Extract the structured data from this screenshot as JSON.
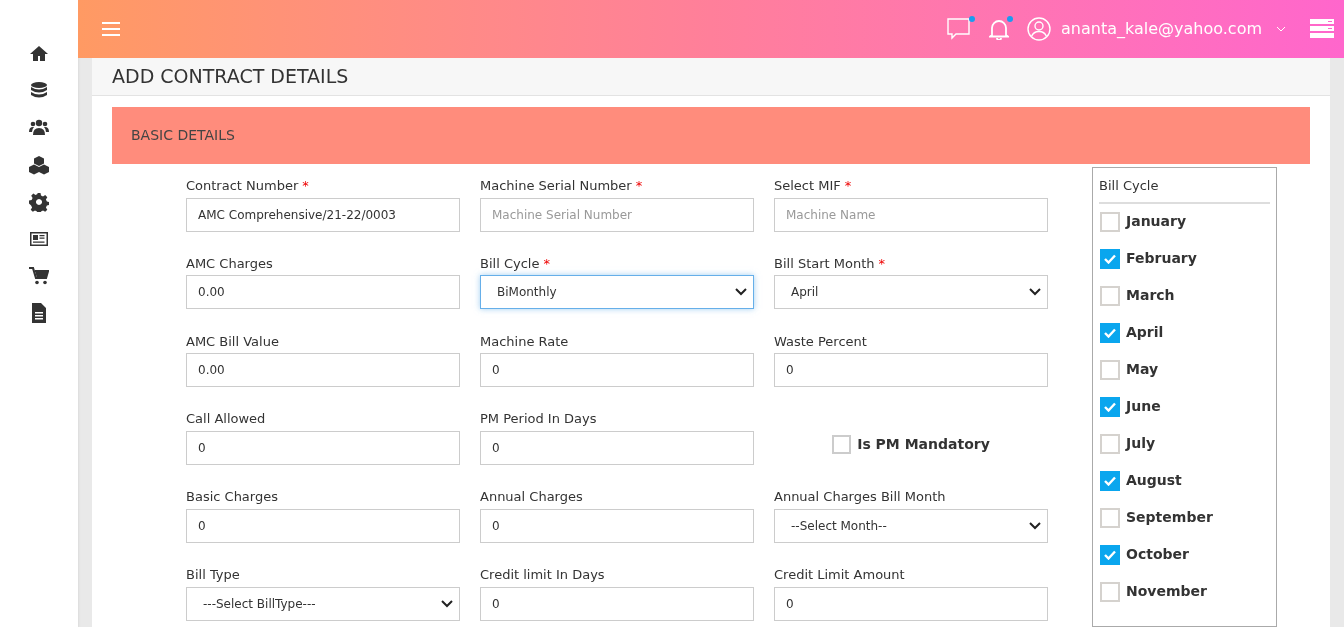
{
  "header": {
    "user": "ananta_kale@yahoo.com",
    "chat_unread": true,
    "bell_unread": true
  },
  "page_title": "ADD CONTRACT DETAILS",
  "section_title": "BASIC DETAILS",
  "fields": [
    {
      "kind": "input",
      "label": "Contract Number",
      "required_mark": "*",
      "value": "AMC Comprehensive/21-22/0003",
      "focused": false
    },
    {
      "kind": "input",
      "label": "Machine Serial Number",
      "required_mark": "*",
      "placeholder": "Machine Serial Number",
      "focused": false
    },
    {
      "kind": "input",
      "label": "Select MIF",
      "required_mark": "*",
      "placeholder": "Machine Name",
      "focused": false
    },
    {
      "kind": "input",
      "label": "AMC Charges",
      "value": "0.00",
      "focused": false
    },
    {
      "kind": "select",
      "label": "Bill Cycle",
      "required_mark": "*",
      "value": "BiMonthly",
      "focused": true
    },
    {
      "kind": "select",
      "label": "Bill Start Month",
      "required_mark": "*",
      "value": "April",
      "focused": false
    },
    {
      "kind": "input",
      "label": "AMC Bill Value",
      "value": "0.00",
      "focused": false
    },
    {
      "kind": "input",
      "label": "Machine Rate",
      "value": "0",
      "focused": false
    },
    {
      "kind": "input",
      "label": "Waste Percent",
      "value": "0",
      "focused": false
    },
    {
      "kind": "input",
      "label": "Call Allowed",
      "value": "0",
      "focused": false
    },
    {
      "kind": "input",
      "label": "PM Period In Days",
      "value": "0",
      "focused": false
    },
    {
      "kind": "checkbox",
      "label": "Is PM Mandatory",
      "checked": false
    },
    {
      "kind": "input",
      "label": "Basic Charges",
      "value": "0",
      "focused": false
    },
    {
      "kind": "input",
      "label": "Annual Charges",
      "value": "0",
      "focused": false
    },
    {
      "kind": "select",
      "label": "Annual Charges Bill Month",
      "value": "--Select Month--",
      "focused": false
    },
    {
      "kind": "select",
      "label": "Bill Type",
      "value": "---Select BillType---",
      "focused": false
    },
    {
      "kind": "input",
      "label": "Credit limit In Days",
      "value": "0",
      "focused": false
    },
    {
      "kind": "input",
      "label": "Credit Limit Amount",
      "value": "0",
      "focused": false
    }
  ],
  "bill_cycle_panel": {
    "title": "Bill Cycle",
    "months": [
      {
        "label": "January",
        "checked": false
      },
      {
        "label": "February",
        "checked": true
      },
      {
        "label": "March",
        "checked": false
      },
      {
        "label": "April",
        "checked": true
      },
      {
        "label": "May",
        "checked": false
      },
      {
        "label": "June",
        "checked": true
      },
      {
        "label": "July",
        "checked": false
      },
      {
        "label": "August",
        "checked": true
      },
      {
        "label": "September",
        "checked": false
      },
      {
        "label": "October",
        "checked": true
      },
      {
        "label": "November",
        "checked": false
      }
    ]
  }
}
